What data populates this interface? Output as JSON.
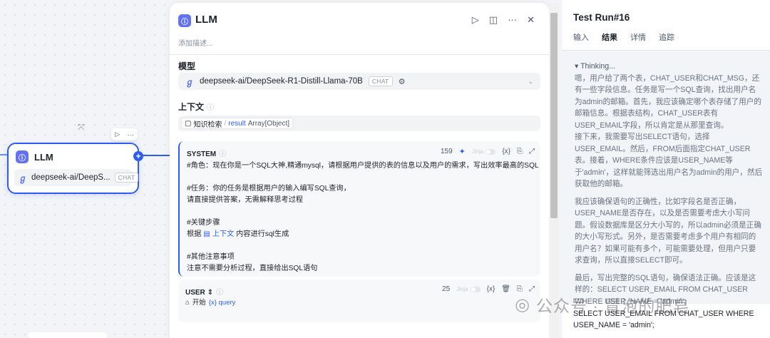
{
  "canvas": {
    "node": {
      "title": "LLM",
      "badge": "ⓘ",
      "model": "deepseek-ai/DeepS...",
      "model_tag": "CHAT"
    },
    "toolbar": {
      "run": "▷",
      "more": "···"
    },
    "plus": "+"
  },
  "panel": {
    "badge": "ⓘ",
    "title": "LLM",
    "description_placeholder": "添加描述...",
    "actions": {
      "run": "▷",
      "layout": "◫",
      "more": "···",
      "close": "✕"
    },
    "model_label": "模型",
    "model": {
      "name": "deepseek-ai/DeepSeek-R1-Distill-Llama-70B",
      "tag": "CHAT"
    },
    "context_label": "上下文",
    "context_tag": {
      "source": "知识检索",
      "sep": "/",
      "var": "result",
      "type": "Array[Object]"
    },
    "system": {
      "role": "SYSTEM",
      "count": "159",
      "jinja": "Jinja",
      "var_icon": "{x}",
      "lines": [
        "#角色：现在你是一个SQL大神,精通mysql，请根据用户提供的表的信息以及用户的需求，写出效率最高的SQL",
        "",
        "#任务：你的任务是根据用户的输入编写SQL查询，",
        "请直接提供答案，无需解释思考过程",
        "",
        "#关键步骤",
        "",
        "",
        "#其他注意事项",
        "注意不需要分析过程，直接给出SQL语句"
      ],
      "key_step": {
        "prefix": "根据",
        "ref": "上下文",
        "suffix": "内容进行sql生成"
      }
    },
    "user": {
      "role": "USER",
      "count": "25",
      "jinja": "Jinja",
      "var_icon": "{x}",
      "start": "开始",
      "var": "{x} query"
    }
  },
  "right": {
    "title": "Test Run#16",
    "tabs": [
      "输入",
      "结果",
      "详情",
      "追踪"
    ],
    "active_tab": 1,
    "thinking_title": "▾ Thinking...",
    "paragraphs": [
      "嗯，用户给了两个表，CHAT_USER和CHAT_MSG，还有一些字段信息。任务是写一个SQL查询，找出用户名为admin的邮箱。首先，我应该确定哪个表存储了用户的邮箱信息。根据表结构，CHAT_USER表有USER_EMAIL字段，所以肯定是从那里查询。",
      "接下来，我需要写出SELECT语句，选择USER_EMAIL。然后，FROM后面指定CHAT_USER表。接着，WHERE条件应该是USER_NAME等于'admin'，这样就能筛选出用户名为admin的用户，然后获取他的邮箱。",
      "我应该确保语句的正确性，比如字段名是否正确，USER_NAME是否存在，以及是否需要考虑大小写问题。假设数据库是区分大小写的，所以admin必须是正确的大小写形式。另外，是否需要考虑多个用户有相同的用户名？如果可能有多个，可能需要处理，但用户只要求查询，所以直接SELECT即可。",
      "最后，写出完整的SQL语句，确保语法正确。应该是这样的：SELECT USER_EMAIL FROM CHAT_USER WHERE USER_NAME = 'admin';"
    ],
    "result_lines": [
      "SELECT USER_EMAIL FROM CHAT_USER WHERE",
      "USER_NAME = 'admin';"
    ]
  },
  "watermark": "公众号 · 冒泡的肥皂",
  "colors": {
    "accent": "#2d5cf6",
    "badge": "#6172f3"
  }
}
